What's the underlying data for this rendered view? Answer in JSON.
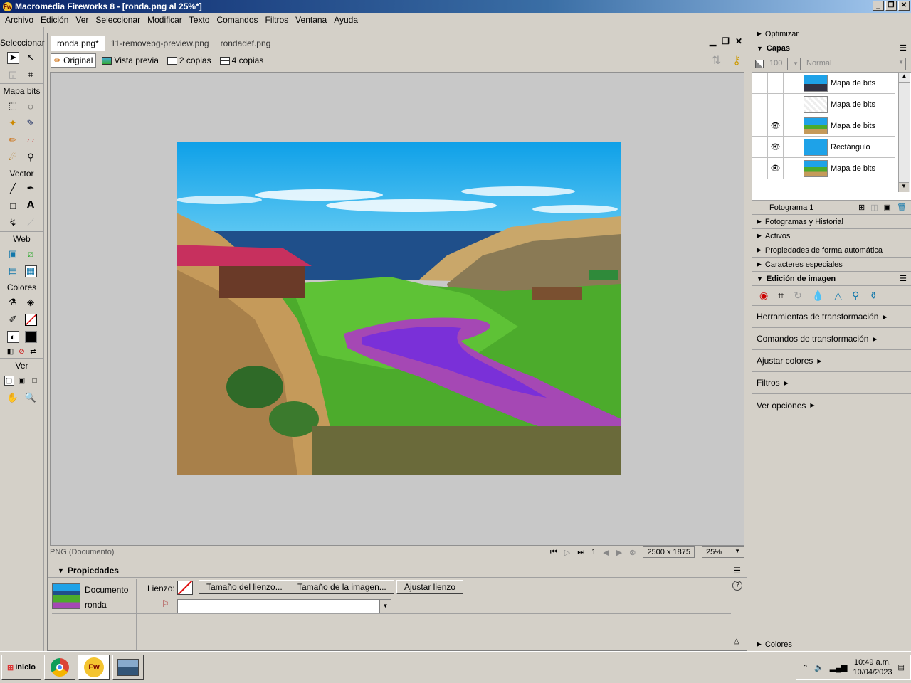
{
  "app": {
    "title": "Macromedia Fireworks 8 - [ronda.png al  25%*]",
    "menu": [
      "Archivo",
      "Edición",
      "Ver",
      "Seleccionar",
      "Modificar",
      "Texto",
      "Comandos",
      "Filtros",
      "Ventana",
      "Ayuda"
    ]
  },
  "toolbox": {
    "sections": {
      "select": "Seleccionar",
      "bitmap": "Mapa bits",
      "vector": "Vector",
      "web": "Web",
      "colors": "Colores",
      "view": "Ver"
    }
  },
  "document": {
    "tabs": [
      "ronda.png*",
      "11-removebg-preview.png",
      "rondadef.png"
    ],
    "view_modes": [
      "Original",
      "Vista previa",
      "2 copias",
      "4 copias"
    ],
    "status_type": "PNG (Documento)",
    "frame": "1",
    "size": "2500 x 1875",
    "zoom": "25%"
  },
  "properties": {
    "title": "Propiedades",
    "doc_label": "Documento",
    "doc_name": "ronda",
    "canvas_label": "Lienzo:",
    "canvas_size_btn": "Tamaño del lienzo...",
    "image_size_btn": "Tamaño de la imagen...",
    "fit_canvas_btn": "Ajustar lienzo",
    "help": "?"
  },
  "panels": {
    "optimize": "Optimizar",
    "layers": "Capas",
    "opacity": "100",
    "blend": "Normal",
    "layer_items": [
      {
        "name": "Mapa de bits",
        "visible": false
      },
      {
        "name": "Mapa de bits",
        "visible": false
      },
      {
        "name": "Mapa de bits",
        "visible": true
      },
      {
        "name": "Rectángulo",
        "visible": true
      },
      {
        "name": "Mapa de bits",
        "visible": true
      }
    ],
    "frame_label": "Fotograma 1",
    "collapsed": [
      "Fotogramas y Historial",
      "Activos",
      "Propiedades de forma automática",
      "Caracteres especiales"
    ],
    "image_edit": "Edición de imagen",
    "image_edit_menus": [
      "Herramientas de transformación",
      "Comandos de transformación",
      "Ajustar colores",
      "Filtros",
      "Ver opciones"
    ],
    "colors": "Colores"
  },
  "taskbar": {
    "start": "Inicio",
    "time": "10:49 a.m.",
    "date": "10/04/2023"
  }
}
